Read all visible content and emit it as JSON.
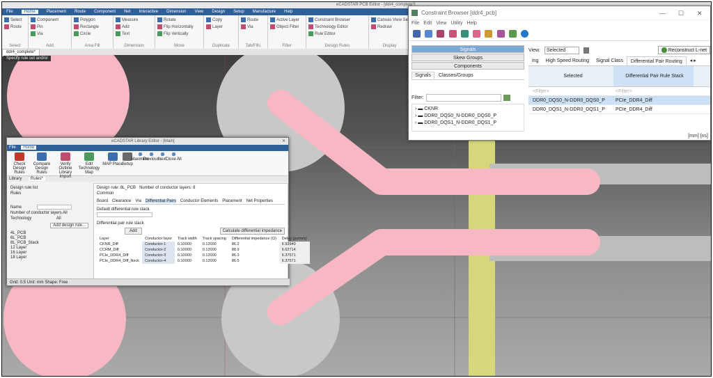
{
  "pcb": {
    "title": "eCADSTAR PCB Editor - [ddr4_complete*]",
    "menu_tabs": [
      "File",
      "Home",
      "Placement",
      "Route",
      "Component",
      "Net",
      "Interactive",
      "Dimension",
      "View",
      "Design",
      "Setup",
      "Manufacture",
      "Help"
    ],
    "active_tab": "Home",
    "ribbon_groups": [
      {
        "label": "Select",
        "items": [
          "Select",
          "Route"
        ]
      },
      {
        "label": "Add",
        "items": [
          "Component",
          "Pin",
          "Via"
        ]
      },
      {
        "label": "Area Fill",
        "items": [
          "Polygon",
          "Rectangle",
          "Circle"
        ]
      },
      {
        "label": "Dimension",
        "items": [
          "Measure",
          "Add",
          "Text"
        ]
      },
      {
        "label": "Move",
        "items": [
          "Rotate",
          "Flip Horizontally",
          "Flip Vertically"
        ]
      },
      {
        "label": "Duplicate",
        "items": [
          "Copy",
          "Layer"
        ]
      },
      {
        "label": "Tab/Fills",
        "items": [
          "Route",
          "Via"
        ]
      },
      {
        "label": "Filter",
        "items": [
          "Active Layer",
          "Object Filter"
        ]
      },
      {
        "label": "Design Rules",
        "items": [
          "Constraint Browser",
          "Technology Editor",
          "Rule Editor"
        ]
      },
      {
        "label": "Display",
        "items": [
          "Canvas View Settings",
          "Redraw"
        ]
      },
      {
        "label": "Clipboard",
        "items": [
          "Cut",
          "Copy",
          "Paste"
        ]
      },
      {
        "label": "Undo",
        "items": [
          "Undo",
          "Redo"
        ]
      }
    ],
    "doc_tab": "ddr4_complete*",
    "tooltip": "Specify rule set and/or",
    "trace_color": "#f7b8c4",
    "pad_color": "#c8c8c8",
    "stripe_color": "#d6d77a"
  },
  "constraint_browser": {
    "title": "Constraint Browser [ddr4_pcb]",
    "window_buttons": [
      "—",
      "☐",
      "✕"
    ],
    "menu": [
      "File",
      "Edit",
      "View",
      "Utility",
      "Help"
    ],
    "nav": [
      "Signals",
      "Skew Groups",
      "Components"
    ],
    "active_nav": "Signals",
    "left_tabs": [
      "Signals",
      "Classes/Groups"
    ],
    "filter_label": "Filter:",
    "tree": [
      "CKNR",
      "DDR0_DQS0_N-DDR0_DQS0_P",
      "DDR0_DQS1_N-DDR0_DQS1_P"
    ],
    "view_label": "View:",
    "view_value": "Selected",
    "reconstruct_label": "Reconstruct L-net",
    "right_tabs": [
      "ing",
      "High Speed Routing",
      "Signal Class",
      "Differential Pair Routing"
    ],
    "active_right_tab": "Differential Pair Routing",
    "col_selected": "Selected",
    "col_rule": "Differential Pair Rule Stack",
    "filter_row": [
      "<Filter>",
      "<Filter>"
    ],
    "rows": [
      {
        "signal": "DDR0_DQS0_N-DDR0_DQS0_P",
        "rule": "PCIe_DDR4_Diff"
      },
      {
        "signal": "DDR0_DQS1_N-DDR0_DQS1_P",
        "rule": "PCIe_DDR4_Diff"
      }
    ],
    "status": "[mm] [ns]"
  },
  "library_editor": {
    "title": "eCADSTAR Library Editor - [Main]",
    "menu_tabs": [
      "File",
      "Home"
    ],
    "ribbon": [
      "Check Design Rules",
      "Compare Design Rules",
      "Verify Outline Library Import",
      "Edit Technology Map",
      "MAP Place",
      "Setup",
      "Maximize",
      "Previous",
      "Next",
      "Close All"
    ],
    "ribbon_groups": [
      "Check",
      "Compare",
      "Import",
      "Tools",
      "Display",
      "Tile"
    ],
    "doc_tabs": [
      "Library",
      "Rules*"
    ],
    "side_title": "Design rule list",
    "side_subtitle": "Rules",
    "name_label": "Name",
    "conductor_label": "Number of conductor layers",
    "conductor_value": "All",
    "technology_label": "Technology",
    "technology_value": "All",
    "add_rule": "Add design rule...",
    "rules": [
      "4L_PCB",
      "6L_PCB",
      "8L_PCB_Stack",
      "12 Layer",
      "16 Layer",
      "18 Layer"
    ],
    "design_rule_label": "Design rule:",
    "design_rule_value": "8L_PCB",
    "ncl_label": "Number of conductor layers:",
    "ncl_value": "8",
    "common": "Common",
    "sub_tabs": [
      "Board",
      "Clearance",
      "Via",
      "Differential Pairs",
      "Conductor Elements",
      "Placement",
      "Net Properties"
    ],
    "default_label": "Default differential rule stack",
    "diff_rule_label": "Differential pair rule stack",
    "add": "Add",
    "calc": "Calculate differential impedance",
    "tbl_header": [
      "Layer",
      "Conductor layer",
      "Track width",
      "Track spacing",
      "Differential impedance (Ω)",
      "Delay (ps/mm)"
    ],
    "tbl_rows": [
      [
        "CKNR_Diff",
        "Conductor-1",
        "0.10000",
        "0.12000",
        "86.2",
        "6.93940"
      ],
      [
        "CCRM_Diff",
        "Conductor-2",
        "0.10000",
        "0.12000",
        "88.9",
        "6.62714"
      ],
      [
        "PCIe_DDR4_Diff",
        "Conductor-3",
        "0.10000",
        "0.12000",
        "86.3",
        "6.37571"
      ],
      [
        "PCIe_DDR4_Diff_Neck",
        "Conductor-4",
        "0.10000",
        "0.12000",
        "86.5",
        "6.37571"
      ]
    ],
    "footer": "Grid: 0.5   Unit: mm   Shape: Free"
  }
}
